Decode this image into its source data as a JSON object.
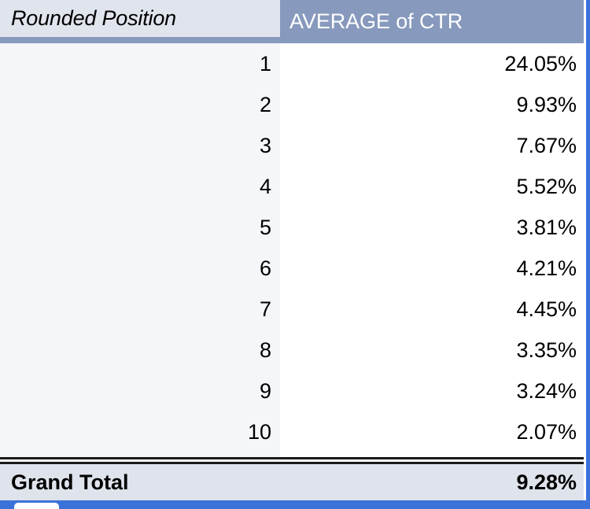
{
  "table": {
    "columns": [
      {
        "id": "position",
        "header": "Rounded Position",
        "align": "right",
        "header_style": "italic"
      },
      {
        "id": "ctr",
        "header": "AVERAGE of CTR",
        "align": "right",
        "header_style": "normal"
      }
    ],
    "rows": [
      {
        "position": "1",
        "ctr": "24.05%"
      },
      {
        "position": "2",
        "ctr": "9.93%"
      },
      {
        "position": "3",
        "ctr": "7.67%"
      },
      {
        "position": "4",
        "ctr": "5.52%"
      },
      {
        "position": "5",
        "ctr": "3.81%"
      },
      {
        "position": "6",
        "ctr": "4.21%"
      },
      {
        "position": "7",
        "ctr": "4.45%"
      },
      {
        "position": "8",
        "ctr": "3.35%"
      },
      {
        "position": "9",
        "ctr": "3.24%"
      },
      {
        "position": "10",
        "ctr": "2.07%"
      }
    ],
    "total": {
      "label": "Grand Total",
      "value": "9.28%"
    }
  },
  "chart_data": {
    "type": "table",
    "title": "AVERAGE of CTR by Rounded Position",
    "xlabel": "Rounded Position",
    "ylabel": "AVERAGE of CTR",
    "categories": [
      "1",
      "2",
      "3",
      "4",
      "5",
      "6",
      "7",
      "8",
      "9",
      "10"
    ],
    "values": [
      24.05,
      9.93,
      7.67,
      5.52,
      3.81,
      4.21,
      4.45,
      3.35,
      3.24,
      2.07
    ],
    "value_labels": [
      "24.05%",
      "9.93%",
      "7.67%",
      "5.52%",
      "3.81%",
      "4.21%",
      "4.45%",
      "3.35%",
      "3.24%",
      "2.07%"
    ],
    "units": "percent",
    "total": 9.28,
    "total_label": "9.28%"
  },
  "colors": {
    "header_accent": "#8799bd",
    "header_left_bg": "#e0e4ec",
    "header_right_text": "#ffffff",
    "body_left_bg": "#f4f6f9",
    "body_right_bg": "#ffffff",
    "total_bg": "#dfe3ec",
    "rule": "#1a1a1a",
    "chrome_blue": "#3b72d9"
  }
}
